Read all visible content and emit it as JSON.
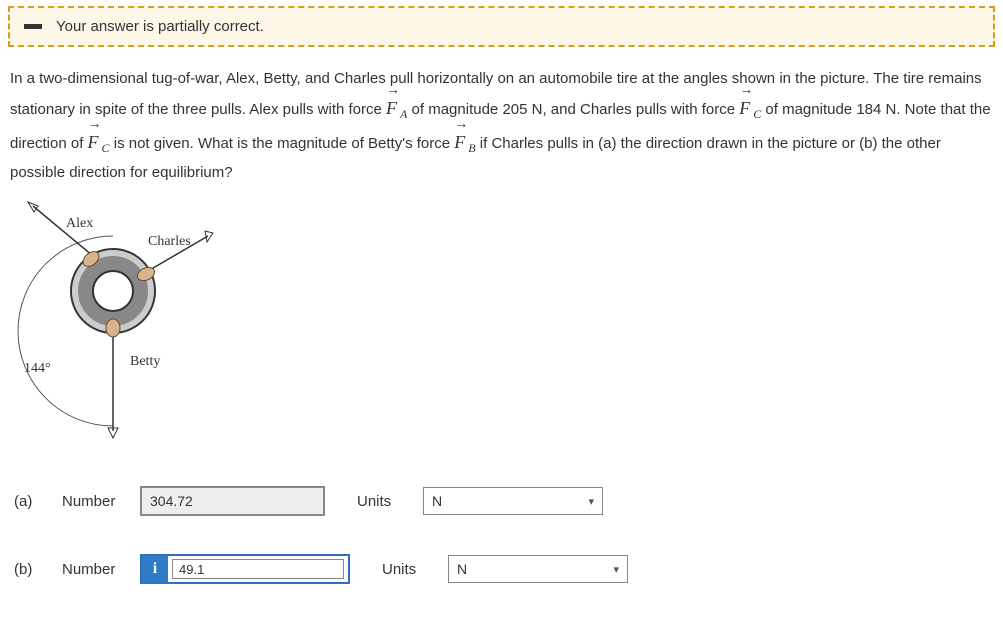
{
  "status": {
    "text": "Your answer is partially correct."
  },
  "problem": {
    "intro": "In a two-dimensional tug-of-war, Alex, Betty, and Charles pull horizontally on an automobile tire at the angles shown in the picture. The tire remains stationary in spite of the three pulls. Alex pulls with force ",
    "F": "F",
    "subA": "A",
    "mid1": " of magnitude 205 N, and Charles pulls with force ",
    "subC": "C",
    "mid2": " of magnitude 184 N. Note that the direction of ",
    "mid3": " is not given. What is the magnitude of Betty's force ",
    "subB": "B",
    "tail": " if Charles pulls in (a) the direction drawn in the picture or (b) the other possible direction for equilibrium?"
  },
  "figure": {
    "alex": "Alex",
    "charles": "Charles",
    "betty": "Betty",
    "angle": "144°"
  },
  "answers": {
    "a": {
      "label": "(a)",
      "numlabel": "Number",
      "value": "304.72",
      "unitslabel": "Units",
      "unit": "N"
    },
    "b": {
      "label": "(b)",
      "numlabel": "Number",
      "info": "i",
      "value": "49.1",
      "unitslabel": "Units",
      "unit": "N"
    }
  }
}
